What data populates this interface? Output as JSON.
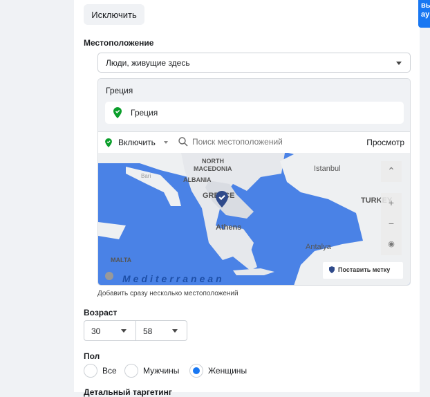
{
  "exclude_button": "Исключить",
  "location": {
    "label": "Местоположение",
    "mode": "Люди, живущие здесь",
    "group_title": "Греция",
    "selected": "Греция",
    "include_label": "Включить",
    "search_placeholder": "Поиск местоположений",
    "browse": "Просмотр",
    "add_multiple": "Добавить сразу несколько местоположений"
  },
  "map": {
    "labels": {
      "north": "NORTH",
      "macedonia": "MACEDONIA",
      "albania": "ALBANIA",
      "greece": "GREECE",
      "athens": "Athens",
      "istanbul": "Istanbul",
      "turkey": "TURKEY",
      "antalya": "Antalya",
      "malta": "MALTA",
      "bari": "Bari",
      "sea": "Mediterranean"
    },
    "drop_pin": "Поставить метку"
  },
  "age": {
    "label": "Возраст",
    "min": "30",
    "max": "58"
  },
  "gender": {
    "label": "Пол",
    "options": [
      "Все",
      "Мужчины",
      "Женщины"
    ],
    "selected": "Женщины"
  },
  "detailed": {
    "label": "Детальный таргетинг"
  },
  "side_button": "вы\nау",
  "colors": {
    "accent": "#1877f2",
    "green": "#31a24c",
    "sea": "#4a82e6"
  }
}
